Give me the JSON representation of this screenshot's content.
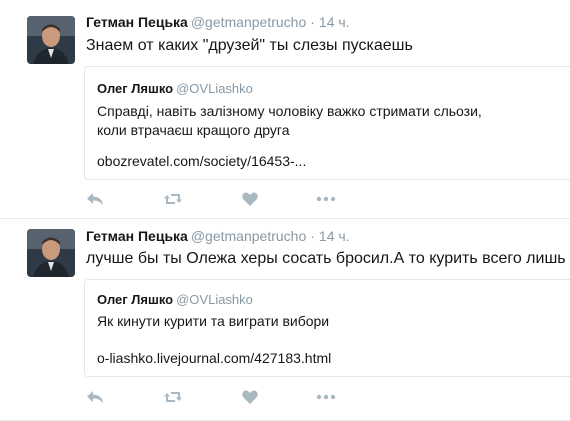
{
  "tweets": [
    {
      "author": {
        "name": "Гетман Пецька",
        "handle": "@getmanpetrucho"
      },
      "separator": "·",
      "time": "14 ч.",
      "text": "Знаем от каких \"друзей\" ты слезы пускаешь",
      "quote": {
        "name": "Олег Ляшко",
        "handle": "@OVLiashko",
        "text": "Справді, навіть залізному чоловіку важко стримати сльози, коли втрачаєш кращого друга",
        "link": "obozrevatel.com/society/16453-..."
      }
    },
    {
      "author": {
        "name": "Гетман Пецька",
        "handle": "@getmanpetrucho"
      },
      "separator": "·",
      "time": "14 ч.",
      "text": "лучше бы ты Олежа херы сосать бросил.А то курить всего лишь",
      "quote": {
        "name": "Олег Ляшко",
        "handle": "@OVLiashko",
        "text": "Як кинути курити та виграти вибори",
        "link": "o-liashko.livejournal.com/427183.html"
      }
    }
  ],
  "icons": {
    "reply": "reply-icon",
    "retweet": "retweet-icon",
    "like": "heart-icon",
    "more": "more-icon"
  },
  "colors": {
    "icon": "#aab8c2",
    "secondary_text": "#8899a6",
    "border": "#e1e8ed"
  }
}
